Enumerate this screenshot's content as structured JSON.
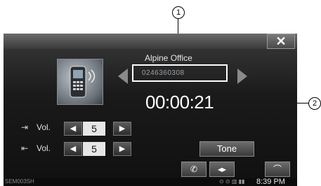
{
  "callouts": {
    "one": "1",
    "two": "2"
  },
  "screen": {
    "close_label": "✕",
    "caller_name": "Alpine Office",
    "caller_number": "0246360308",
    "call_timer": "00:00:21"
  },
  "volume": {
    "label": "Vol.",
    "rows": [
      {
        "icon": "⇥",
        "value": "5",
        "dec": "◀",
        "inc": "▶"
      },
      {
        "icon": "⇤",
        "value": "5",
        "dec": "◀",
        "inc": "▶"
      }
    ]
  },
  "buttons": {
    "tone": "Tone",
    "phone": "✆",
    "transfer": "◂▸",
    "hangup": "⌒"
  },
  "status": {
    "code": "SEM003SH",
    "icons": "⊙ ⊙ ▥ ▮▮",
    "clock": "8:39 PM"
  }
}
